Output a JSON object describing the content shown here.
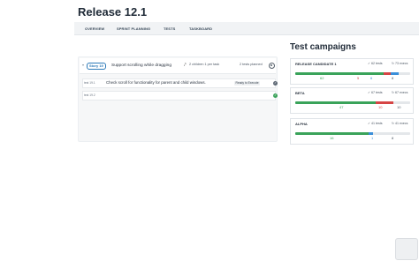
{
  "page": {
    "title": "Release 12.1"
  },
  "tabs": [
    {
      "label": "OVERVIEW"
    },
    {
      "label": "SPRINT PLANNING"
    },
    {
      "label": "TESTS"
    },
    {
      "label": "TASKBOARD"
    }
  ],
  "story": {
    "badge": "Story 19",
    "title": "Support scrolling while dragging",
    "meta": "2 children 1 per task",
    "tests_planned": "2 tests planned"
  },
  "tests": [
    {
      "id": "test 19.1",
      "title": "Check scroll for functionality for parent and child windows.",
      "status": "Ready to Execute"
    },
    {
      "id": "test 19.2",
      "title": "",
      "status": ""
    }
  ],
  "section": {
    "title": "Test campaigns"
  },
  "campaigns": [
    {
      "name": "RELEASE CANDIDATE 1",
      "tests": "62 tests",
      "execs": "73 execs",
      "passed": 62,
      "failed": 5,
      "blocked": 6,
      "untested": 8
    },
    {
      "name": "BETA",
      "tests": "67 tests",
      "execs": "67 execs",
      "passed": 47,
      "failed": 10,
      "blocked": 0,
      "untested": 10
    },
    {
      "name": "ALPHA",
      "tests": "41 tests",
      "execs": "41 execs",
      "passed": 16,
      "failed": 0,
      "blocked": 1,
      "untested": 8
    }
  ],
  "colors": {
    "passed": "#3aa35a",
    "failed": "#d64545",
    "blocked": "#3b8fd9",
    "untested": "#e4e7ea"
  }
}
